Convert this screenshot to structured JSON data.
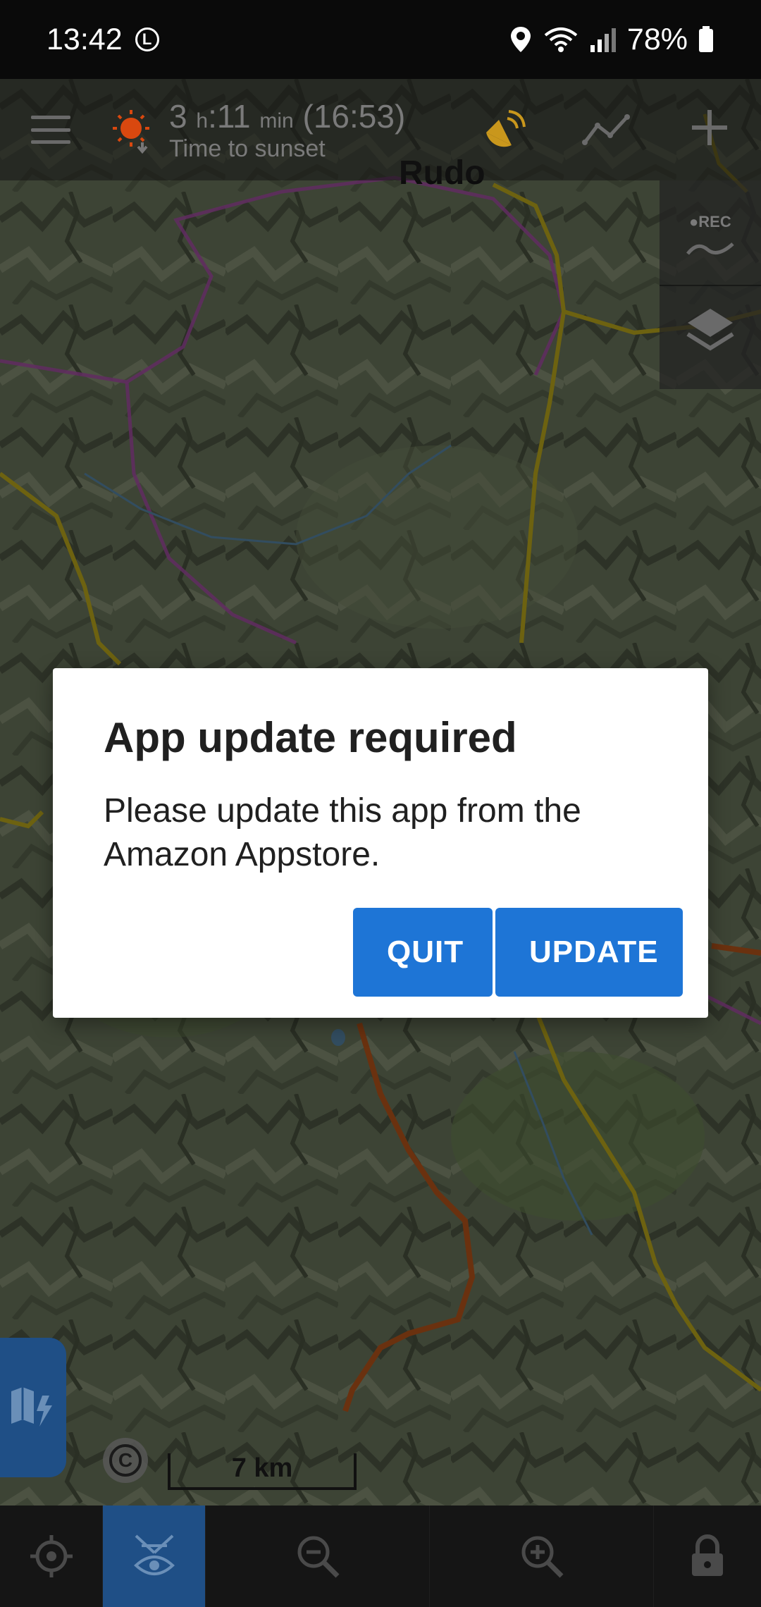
{
  "status_bar": {
    "time": "13:42",
    "mode_badge": "L",
    "battery": "78%",
    "icons": [
      "location-icon",
      "wifi-icon",
      "signal-icon",
      "battery-icon"
    ]
  },
  "topbar": {
    "sunset_hours": "3",
    "sunset_h_unit": "h",
    "sunset_minutes": ":11",
    "sunset_min_unit": "min",
    "sunset_clock": "(16:53)",
    "sunset_label": "Time to sunset"
  },
  "map": {
    "place_label": "Rudo",
    "scale_label": "7 km",
    "copyright_symbol": "C"
  },
  "right_panel": {
    "rec_label": "●REC"
  },
  "dialog": {
    "title": "App update required",
    "message": "Please update this app from the Amazon Appstore.",
    "quit_label": "QUIT",
    "update_label": "UPDATE"
  },
  "colors": {
    "accent": "#1e75d6",
    "active_tab": "#1f4f86",
    "sun": "#d9480f",
    "satellite": "#c9971c"
  }
}
